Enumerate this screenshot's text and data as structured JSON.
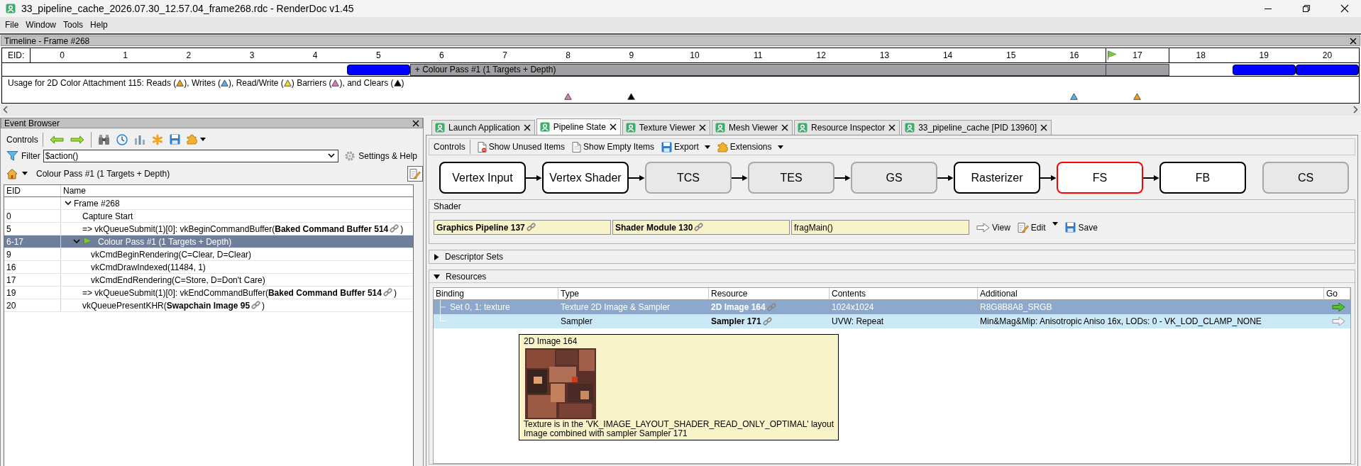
{
  "window": {
    "title": "33_pipeline_cache_2026.07.30_12.57.04_frame268.rdc - RenderDoc v1.45"
  },
  "menu": [
    "File",
    "Window",
    "Tools",
    "Help"
  ],
  "timeline": {
    "title": "Timeline - Frame #268",
    "eid_label": "EID:",
    "pass_label": "+ Colour Pass #1 (1 Targets + Depth)",
    "columns": [
      {
        "label": "0",
        "kind": "empty"
      },
      {
        "label": "1",
        "kind": "empty"
      },
      {
        "label": "2",
        "kind": "empty"
      },
      {
        "label": "3",
        "kind": "empty"
      },
      {
        "label": "4",
        "kind": "empty"
      },
      {
        "label": "5",
        "kind": "action"
      },
      {
        "label": "6",
        "kind": "pass"
      },
      {
        "label": "7",
        "kind": "pass"
      },
      {
        "label": "8",
        "kind": "pass",
        "usage": {
          "color": "#d080b4"
        }
      },
      {
        "label": "9",
        "kind": "pass",
        "usage": {
          "color": "#000000"
        }
      },
      {
        "label": "10",
        "kind": "pass"
      },
      {
        "label": "11",
        "kind": "pass"
      },
      {
        "label": "12",
        "kind": "pass"
      },
      {
        "label": "13",
        "kind": "pass"
      },
      {
        "label": "14",
        "kind": "pass"
      },
      {
        "label": "15",
        "kind": "pass"
      },
      {
        "label": "16",
        "kind": "pass",
        "usage": {
          "color": "#5ab0e6"
        }
      },
      {
        "label": "17",
        "kind": "pass",
        "usage": {
          "color": "#eaa020"
        },
        "current": true
      },
      {
        "label": "18",
        "kind": "empty"
      },
      {
        "label": "19",
        "kind": "action"
      },
      {
        "label": "20",
        "kind": "action"
      }
    ],
    "legend": [
      {
        "text": "Usage for 2D Color Attachment 115: Reads (",
        "color": "#eaa020"
      },
      {
        "text": "), Writes (",
        "color": "#5ab0e6"
      },
      {
        "text": "), Read/Write (",
        "color": "#f0dc30"
      },
      {
        "text": ") Barriers (",
        "color": "#d080b4"
      },
      {
        "text": "), and Clears (",
        "color": "#000000"
      },
      {
        "text": ")"
      }
    ]
  },
  "event_browser": {
    "title": "Event Browser",
    "controls_label": "Controls",
    "filter_label": "Filter",
    "filter_value": "$action()",
    "settings_label": "Settings & Help",
    "breadcrumb": "Colour Pass #1 (1 Targets + Depth)",
    "columns": [
      "EID",
      "Name"
    ],
    "events": [
      {
        "name": "Frame #268",
        "expanded": true,
        "selected": false,
        "current": false,
        "children": [
          {
            "eid": "0",
            "name": "Capture Start",
            "expanded": false,
            "selected": false,
            "current": false
          },
          {
            "eid": "5",
            "name": "=> vkQueueSubmit(1)[0]: vkBeginCommandBuffer(**Baked Command Buffer 514**",
            "link": true,
            "name_end": ")",
            "expanded": false,
            "selected": false,
            "current": false
          },
          {
            "eid": "6-17",
            "name": "Colour Pass #1 (1 Targets + Depth)",
            "expanded": true,
            "selected": true,
            "current": true,
            "children": [
              {
                "eid": "9",
                "name": "vkCmdBeginRendering(C=Clear, D=Clear)",
                "expanded": false,
                "selected": false,
                "current": false
              },
              {
                "eid": "16",
                "name": "vkCmdDrawIndexed(11484, 1)",
                "expanded": false,
                "selected": false,
                "current": false
              },
              {
                "eid": "17",
                "name": "vkCmdEndRendering(C=Store, D=Don't Care)",
                "expanded": false,
                "selected": false,
                "current": false
              }
            ]
          },
          {
            "eid": "19",
            "name": "=> vkQueueSubmit(1)[0]: vkEndCommandBuffer(**Baked Command Buffer 514**",
            "link": true,
            "name_end": ")",
            "expanded": false,
            "selected": false,
            "current": false
          },
          {
            "eid": "20",
            "name": "vkQueuePresentKHR(**Swapchain Image 95**",
            "link": true,
            "name_end": ")",
            "expanded": false,
            "selected": false,
            "current": false
          }
        ]
      }
    ]
  },
  "tabs": [
    {
      "label": "Launch Application",
      "selected": false
    },
    {
      "label": "Pipeline State",
      "selected": true
    },
    {
      "label": "Texture Viewer",
      "selected": false
    },
    {
      "label": "Mesh Viewer",
      "selected": false
    },
    {
      "label": "Resource Inspector",
      "selected": false
    },
    {
      "label": "33_pipeline_cache [PID 13960]",
      "selected": false
    }
  ],
  "pipeline_state": {
    "toolbar": {
      "label": "Controls",
      "buttons": [
        {
          "label": "Show Unused Items",
          "kind": "unused",
          "dropdown": false
        },
        {
          "label": "Show Empty Items",
          "kind": "empty",
          "dropdown": false
        },
        {
          "label": "Export",
          "kind": "export",
          "dropdown": true
        },
        {
          "label": "Extensions",
          "kind": "extensions",
          "dropdown": true
        }
      ]
    },
    "stages": [
      {
        "label": "Vertex Input",
        "kind": "graphics",
        "enabled": true,
        "selected": false
      },
      {
        "label": "Vertex Shader",
        "kind": "graphics",
        "enabled": true,
        "selected": false
      },
      {
        "label": "TCS",
        "kind": "graphics",
        "enabled": false,
        "selected": false
      },
      {
        "label": "TES",
        "kind": "graphics",
        "enabled": false,
        "selected": false
      },
      {
        "label": "GS",
        "kind": "graphics",
        "enabled": false,
        "selected": false
      },
      {
        "label": "Rasterizer",
        "kind": "graphics",
        "enabled": true,
        "selected": false
      },
      {
        "label": "FS",
        "kind": "graphics",
        "enabled": true,
        "selected": true
      },
      {
        "label": "FB",
        "kind": "graphics",
        "enabled": true,
        "selected": false
      },
      {
        "label": "CS",
        "kind": "compute",
        "enabled": false,
        "selected": false
      }
    ],
    "shader": {
      "title": "Shader",
      "pipeline": "Graphics Pipeline 137",
      "module": "Shader Module 130",
      "entry": "fragMain()",
      "actions": [
        {
          "label": "View",
          "kind": "view",
          "dropdown": false
        },
        {
          "label": "Edit",
          "kind": "edit",
          "dropdown": true
        },
        {
          "label": "Save",
          "kind": "save",
          "dropdown": false
        }
      ]
    },
    "sections": [
      {
        "title": "Descriptor Sets",
        "expanded": false
      },
      {
        "title": "Resources",
        "expanded": true,
        "table": {
          "columns": [
            "Binding",
            "Type",
            "Resource",
            "Contents",
            "Additional",
            "Go"
          ],
          "rows": [
            {
              "binding": "Set 0, 1: texture",
              "type": "Texture 2D Image & Sampler",
              "resource": "2D Image 164",
              "contents": "1024x1024",
              "additional": "R8G8B8A8_SRGB",
              "selected": true,
              "go_enabled": true
            },
            {
              "type": "Sampler",
              "resource": "Sampler 171",
              "contents": "UVW: Repeat",
              "additional": "Min&Mag&Mip: Anisotropic Aniso 16x, LODs: 0 - VK_LOD_CLAMP_NONE",
              "selected": false,
              "go_enabled": false
            }
          ]
        }
      }
    ]
  },
  "tooltip": {
    "title": "2D Image 164",
    "lines": [
      "Texture is in the 'VK_IMAGE_LAYOUT_SHADER_READ_ONLY_OPTIMAL' layout",
      "Image combined with sampler Sampler 171"
    ]
  }
}
